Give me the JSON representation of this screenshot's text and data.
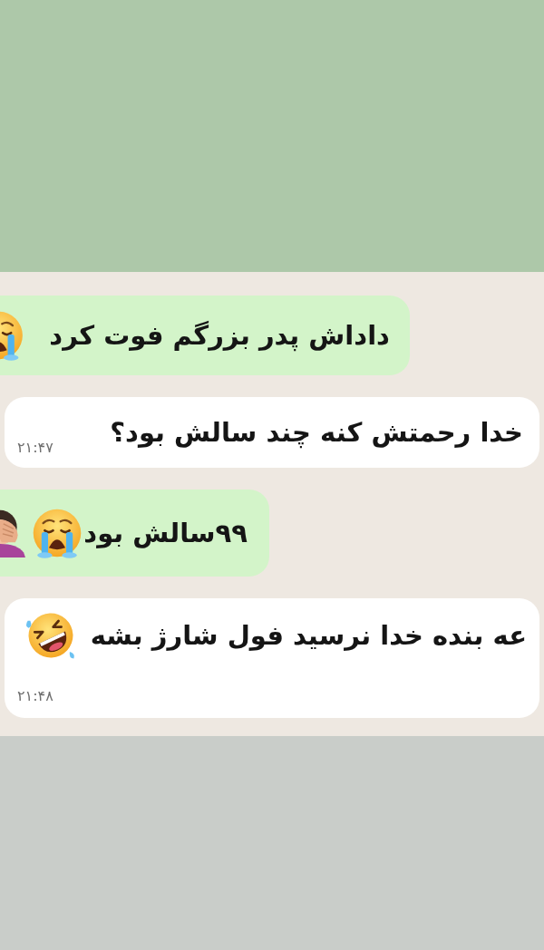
{
  "chat": {
    "messages": [
      {
        "kind": "sent",
        "text": "داداش پدر بزرگم فوت کرد"
      },
      {
        "kind": "received",
        "text": "خدا رحمتش کنه چند سالش بود؟",
        "time": "۲۱:۴۷"
      },
      {
        "kind": "sent",
        "text": "۹۹سالش بود"
      },
      {
        "kind": "received",
        "text": "عه بنده خدا نرسید فول شارژ بشه",
        "time": "۲۱:۴۸"
      }
    ]
  }
}
